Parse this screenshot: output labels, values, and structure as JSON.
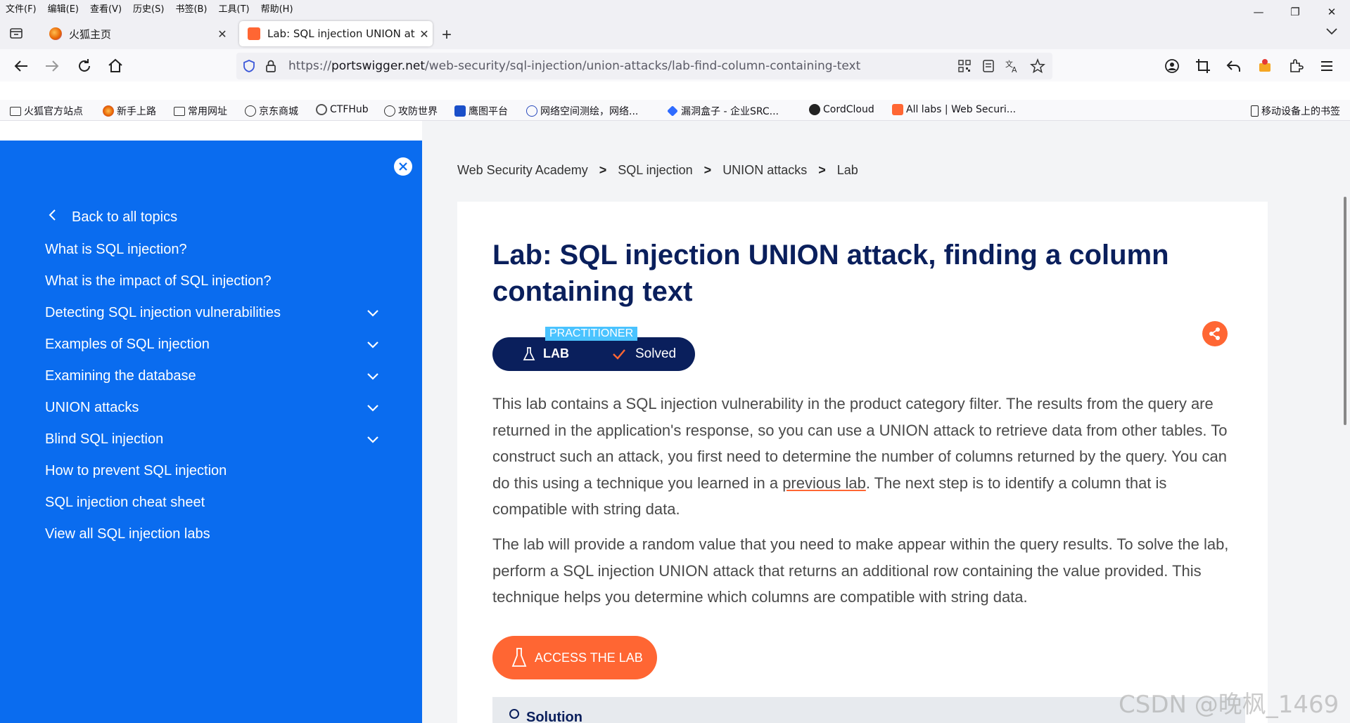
{
  "menubar": {
    "items": [
      "文件(F)",
      "编辑(E)",
      "查看(V)",
      "历史(S)",
      "书签(B)",
      "工具(T)",
      "帮助(H)"
    ]
  },
  "tabs": [
    {
      "title": "火狐主页",
      "favicon_color": "#e66000"
    },
    {
      "title": "Lab: SQL injection UNION at",
      "favicon_color": "#ff6633",
      "active": true
    }
  ],
  "navbar": {
    "url_prefix": "https://",
    "url_domain": "portswigger.net",
    "url_path": "/web-security/sql-injection/union-attacks/lab-find-column-containing-text"
  },
  "bookmarks": [
    {
      "label": "火狐官方站点",
      "icon": "folder-icon"
    },
    {
      "label": "新手上路",
      "icon": "firefox-icon"
    },
    {
      "label": "常用网址",
      "icon": "folder-icon"
    },
    {
      "label": "京东商城",
      "icon": "globe-icon"
    },
    {
      "label": "CTFHub",
      "icon": "ctfhub-icon"
    },
    {
      "label": "攻防世界",
      "icon": "globe-icon"
    },
    {
      "label": "鹰图平台",
      "icon": "hunter-icon"
    },
    {
      "label": "网络空间测绘，网络...",
      "icon": "fofa-icon"
    },
    {
      "label": "漏洞盒子 - 企业SRC...",
      "icon": "vulbox-icon"
    },
    {
      "label": "CordCloud",
      "icon": "cordcloud-icon"
    },
    {
      "label": "All labs | Web Securi...",
      "icon": "portswigger-icon"
    }
  ],
  "bookmarks_right": "移动设备上的书签",
  "sidebar": {
    "back_label": "Back to all topics",
    "items": [
      {
        "label": "What is SQL injection?",
        "expandable": false
      },
      {
        "label": "What is the impact of SQL injection?",
        "expandable": false
      },
      {
        "label": "Detecting SQL injection vulnerabilities",
        "expandable": true
      },
      {
        "label": "Examples of SQL injection",
        "expandable": true
      },
      {
        "label": "Examining the database",
        "expandable": true
      },
      {
        "label": "UNION attacks",
        "expandable": true
      },
      {
        "label": "Blind SQL injection",
        "expandable": true
      },
      {
        "label": "How to prevent SQL injection",
        "expandable": false
      },
      {
        "label": "SQL injection cheat sheet",
        "expandable": false
      },
      {
        "label": "View all SQL injection labs",
        "expandable": false
      }
    ]
  },
  "breadcrumb": {
    "items": [
      "Web Security Academy",
      "SQL injection",
      "UNION attacks",
      "Lab"
    ],
    "separator": ">"
  },
  "lab": {
    "title": "Lab: SQL injection UNION attack, finding a column containing text",
    "level": "PRACTITIONER",
    "badge_label": "LAB",
    "status": "Solved",
    "para1_before": "This lab contains a SQL injection vulnerability in the product category filter. The results from the query are returned in the application's response, so you can use a UNION attack to retrieve data from other tables. To construct such an attack, you first need to determine the number of columns returned by the query. You can do this using a technique you learned in a ",
    "para1_link": "previous lab",
    "para1_after": ". The next step is to identify a column that is compatible with string data.",
    "para2": "The lab will provide a random value that you need to make appear within the query results. To solve the lab, perform a SQL injection UNION attack that returns an additional row containing the value provided. This technique helps you determine which columns are compatible with string data.",
    "access_button": "ACCESS THE LAB",
    "solution_label": "Solution"
  },
  "colors": {
    "sidebar_bg": "#0a6cef",
    "title": "#0a1f5c",
    "accent": "#ff6633",
    "practitioner": "#4ac3ff"
  },
  "watermark": "CSDN @晚枫_1469"
}
